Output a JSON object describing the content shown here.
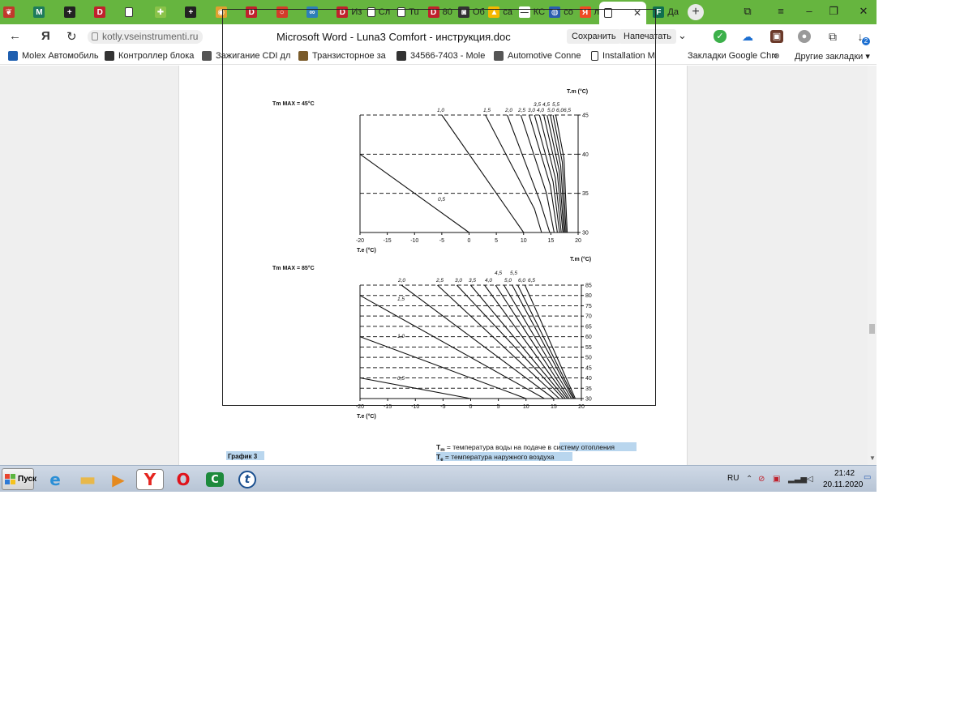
{
  "browser": {
    "tabs": [
      {
        "label": "",
        "icon": "leaf-icon",
        "color": "#c0392b"
      },
      {
        "label": "",
        "icon": "m-logo-icon",
        "color": "#1e7b5c"
      },
      {
        "label": "",
        "icon": "plus-box-icon",
        "color": "#222222"
      },
      {
        "label": "",
        "icon": "d-logo-icon",
        "color": "#c0212c"
      },
      {
        "label": "",
        "icon": "page-icon",
        "color": "#ffffff"
      },
      {
        "label": "",
        "icon": "puzzle-icon",
        "color": "#8bc34a"
      },
      {
        "label": "",
        "icon": "plus-box-icon",
        "color": "#222222"
      },
      {
        "label": "",
        "icon": "cookie-icon",
        "color": "#e0a030"
      },
      {
        "label": "",
        "icon": "d-logo-icon",
        "color": "#c0212c"
      },
      {
        "label": "",
        "icon": "ring-icon",
        "color": "#d23c2a"
      },
      {
        "label": "",
        "icon": "infinity-icon",
        "color": "#2d7fb8"
      },
      {
        "label": "Из",
        "icon": "d-logo-icon",
        "color": "#c0212c"
      },
      {
        "label": "Сл",
        "icon": "page-icon",
        "color": "#ffffff"
      },
      {
        "label": "Tu",
        "icon": "page-icon",
        "color": "#ffffff"
      },
      {
        "label": "80",
        "icon": "d-logo-icon",
        "color": "#c0212c"
      },
      {
        "label": "Об",
        "icon": "camera-icon",
        "color": "#333333"
      },
      {
        "label": "са",
        "icon": "hat-icon",
        "color": "#f5b800"
      },
      {
        "label": "КС",
        "icon": "dash-icon",
        "color": "#ffffff"
      },
      {
        "label": "со",
        "icon": "globe-icon",
        "color": "#2a5db0"
      },
      {
        "label": "лу",
        "icon": "yandex-icon",
        "color": "#f04b24"
      },
      {
        "label": "",
        "icon": "page-icon",
        "color": "#ffffff",
        "active": true
      },
      {
        "label": "Да",
        "icon": "f-logo-icon",
        "color": "#0f6f4f"
      }
    ],
    "active_tab_close": "✕",
    "new_tab": "+",
    "address": {
      "logo": "Я",
      "url": "kotly.vseinstrumenti.ru",
      "title": "Microsoft Word - Luna3 Comfort - инструкция.doc",
      "save_label": "Сохранить",
      "print_label": "Напечатать",
      "download_badge": "2"
    },
    "bookmarks": [
      {
        "label": "Molex Автомобиль",
        "icon": "molex-icon",
        "color": "#1f5fb0"
      },
      {
        "label": "Контроллер блока",
        "icon": "car-icon",
        "color": "#333333"
      },
      {
        "label": "Зажигание CDI дл",
        "icon": "moto-icon",
        "color": "#555555"
      },
      {
        "label": "Транзисторное за",
        "icon": "moto-icon",
        "color": "#7a5b2a"
      },
      {
        "label": "34566-7403 - Mole",
        "icon": "n-logo-icon",
        "color": "#333333"
      },
      {
        "label": "Automotive Conne",
        "icon": "pdf-icon",
        "color": "#555555"
      },
      {
        "label": "Installation M",
        "icon": "page-icon",
        "color": "#ffffff"
      },
      {
        "label": "Закладки Google Chro",
        "icon": "",
        "color": ""
      }
    ],
    "bookmarks_more": "»",
    "other_bookmarks": "Другие закладки"
  },
  "document": {
    "chart1_max_label": "Tm MAX = 45°C",
    "chart2_max_label": "Tm MAX = 85°C",
    "tm_axis_label": "T.m (°C)",
    "te_axis_label": "T.e (°C)",
    "caption": "График 3",
    "legend_tm_symbol": "T",
    "legend_tm_sub": "m",
    "legend_tm_text": " = температура воды на подаче в системy отопления",
    "legend_te_symbol": "T",
    "legend_te_sub": "e",
    "legend_te_text": " = температура наружного воздуха"
  },
  "chart_data": [
    {
      "type": "line",
      "title": "Tm MAX = 45°C",
      "xlabel": "T.e (°C)",
      "ylabel": "T.m (°C)",
      "x_ticks": [
        -20,
        -15,
        -10,
        -5,
        0,
        5,
        10,
        15,
        20
      ],
      "y_ticks": [
        30,
        35,
        40,
        45
      ],
      "xlim": [
        -20,
        20
      ],
      "ylim": [
        30,
        45
      ],
      "grid": "dashed horizontal at 35, 40, 45",
      "series": [
        {
          "name": "0,5",
          "points": [
            [
              -20,
              40
            ],
            [
              0,
              30
            ]
          ]
        },
        {
          "name": "1,0",
          "points": [
            [
              -5,
              45
            ],
            [
              10,
              30
            ]
          ]
        },
        {
          "name": "1,5",
          "points": [
            [
              3,
              45
            ],
            [
              12,
              33
            ],
            [
              13.3,
              30
            ]
          ]
        },
        {
          "name": "2,0",
          "points": [
            [
              7,
              45
            ],
            [
              13,
              34
            ],
            [
              14.8,
              30
            ]
          ]
        },
        {
          "name": "2,5",
          "points": [
            [
              9.5,
              45
            ],
            [
              14.2,
              35
            ],
            [
              15.6,
              30
            ]
          ]
        },
        {
          "name": "3,0",
          "points": [
            [
              11,
              45
            ],
            [
              14.9,
              36
            ],
            [
              16.2,
              30
            ]
          ]
        },
        {
          "name": "3,5",
          "points": [
            [
              12,
              45
            ],
            [
              15.4,
              36.5
            ],
            [
              16.6,
              30
            ]
          ]
        },
        {
          "name": "4,0",
          "points": [
            [
              12.9,
              45
            ],
            [
              15.8,
              37
            ],
            [
              16.9,
              30
            ]
          ]
        },
        {
          "name": "4,5",
          "points": [
            [
              13.7,
              45
            ],
            [
              16.2,
              37.5
            ],
            [
              17.2,
              30
            ]
          ]
        },
        {
          "name": "5,0",
          "points": [
            [
              14.3,
              45
            ],
            [
              16.5,
              38
            ],
            [
              17.4,
              30
            ]
          ]
        },
        {
          "name": "5,5",
          "points": [
            [
              14.9,
              45
            ],
            [
              16.8,
              38.5
            ],
            [
              17.6,
              30
            ]
          ]
        },
        {
          "name": "6,0",
          "points": [
            [
              15.4,
              45
            ],
            [
              17.1,
              39
            ],
            [
              17.8,
              30
            ]
          ]
        },
        {
          "name": "6,5",
          "points": [
            [
              15.9,
              45
            ],
            [
              17.4,
              39.5
            ],
            [
              18,
              30
            ]
          ]
        }
      ]
    },
    {
      "type": "line",
      "title": "Tm MAX = 85°C",
      "xlabel": "T.e (°C)",
      "ylabel": "T.m (°C)",
      "x_ticks": [
        -20,
        -15,
        -10,
        -5,
        0,
        5,
        10,
        15,
        20
      ],
      "y_ticks": [
        30,
        35,
        40,
        45,
        50,
        55,
        60,
        65,
        70,
        75,
        80,
        85
      ],
      "xlim": [
        -20,
        20
      ],
      "ylim": [
        30,
        85
      ],
      "grid": "dashed horizontal at every 5",
      "series": [
        {
          "name": "0,5",
          "points": [
            [
              -20,
              40
            ],
            [
              0,
              30
            ]
          ]
        },
        {
          "name": "1,0",
          "points": [
            [
              -20,
              60
            ],
            [
              10,
              30
            ]
          ]
        },
        {
          "name": "1,5",
          "points": [
            [
              -20,
              80
            ],
            [
              13.3,
              30
            ]
          ]
        },
        {
          "name": "2,0",
          "points": [
            [
              -12.5,
              85
            ],
            [
              15,
              30
            ]
          ]
        },
        {
          "name": "2,5",
          "points": [
            [
              -6,
              85
            ],
            [
              16,
              30
            ]
          ]
        },
        {
          "name": "3,0",
          "points": [
            [
              -2.5,
              85
            ],
            [
              16.7,
              30
            ]
          ]
        },
        {
          "name": "3,5",
          "points": [
            [
              0,
              85
            ],
            [
              17.1,
              30
            ]
          ]
        },
        {
          "name": "4,0",
          "points": [
            [
              2.5,
              85
            ],
            [
              17.5,
              30
            ]
          ]
        },
        {
          "name": "4,5",
          "points": [
            [
              4.5,
              85
            ],
            [
              17.8,
              30
            ]
          ]
        },
        {
          "name": "5,0",
          "points": [
            [
              6,
              85
            ],
            [
              18.2,
              30
            ]
          ]
        },
        {
          "name": "5,5",
          "points": [
            [
              7.5,
              85
            ],
            [
              18.5,
              30
            ]
          ]
        },
        {
          "name": "6,0",
          "points": [
            [
              8.5,
              85
            ],
            [
              18.7,
              30
            ]
          ]
        },
        {
          "name": "6,5",
          "points": [
            [
              9.8,
              85
            ],
            [
              18.9,
              30
            ]
          ]
        }
      ]
    }
  ],
  "taskbar": {
    "start_label": "Пуск",
    "apps": [
      {
        "icon": "ie-icon",
        "color": "#2b8fd6"
      },
      {
        "icon": "folder-icon",
        "color": "#e8b84a"
      },
      {
        "icon": "media-player-icon",
        "color": "#e58a1f"
      },
      {
        "icon": "yandex-browser-icon",
        "color": "#e52620",
        "active": true
      },
      {
        "icon": "opera-icon",
        "color": "#e0131b"
      },
      {
        "icon": "cs-app-icon",
        "color": "#1d8a3c"
      },
      {
        "icon": "teamviewer-icon",
        "color": "#1a4f8f"
      }
    ],
    "lang": "RU",
    "time": "21:42",
    "date": "20.11.2020"
  }
}
